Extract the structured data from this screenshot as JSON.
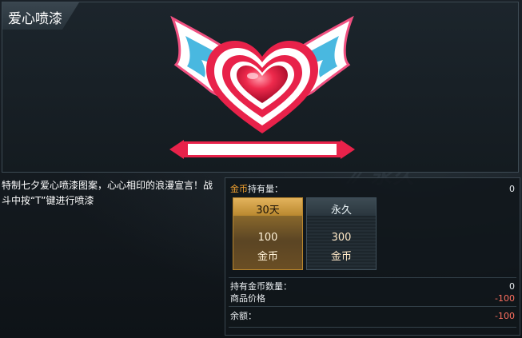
{
  "preview": {
    "title": "爱心喷漆"
  },
  "description": "特制七夕爱心喷漆图案，心心相印的浪漫宣言！战斗中按“T”键进行喷漆",
  "balance": {
    "currency_label": "金币",
    "held_label": "持有量：",
    "held_value": "0"
  },
  "options": [
    {
      "duration": "30天",
      "price": "100",
      "unit": "金币",
      "selected": true
    },
    {
      "duration": "永久",
      "price": "300",
      "unit": "金币",
      "selected": false
    }
  ],
  "summary": {
    "held_coins_label": "持有金币数量：",
    "held_coins_value": "0",
    "price_label": "商品价格",
    "price_value": "-100",
    "remaining_label": "余额：",
    "remaining_value": "-100"
  },
  "colors": {
    "accent_gold": "#f0a030",
    "negative": "#ff7060",
    "heart_red": "#e8224a",
    "wing_blue": "#49b8e0"
  }
}
